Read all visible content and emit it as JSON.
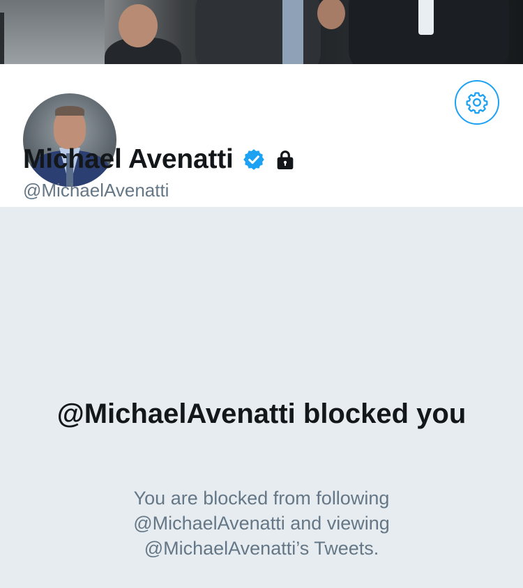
{
  "profile": {
    "display_name": "Michael Avenatti",
    "handle": "@MichaelAvenatti",
    "verified": true,
    "protected": true
  },
  "icons": {
    "settings": "gear-icon",
    "verified": "verified-badge-icon",
    "lock": "lock-icon"
  },
  "blocked": {
    "title": "@MichaelAvenatti blocked you",
    "description": "You are blocked from following @MichaelAvenatti and viewing @MichaelAvenatti’s Tweets."
  },
  "colors": {
    "accent": "#1da1f2",
    "text_primary": "#14171a",
    "text_secondary": "#657786",
    "background": "#e6ecf0"
  }
}
